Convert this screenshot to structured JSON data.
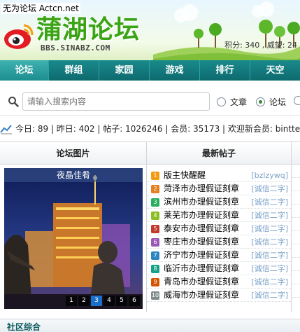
{
  "header": {
    "site_top_text": "无为论坛 Actcn.net",
    "logo_title": "蒲湖论坛",
    "logo_url": "BBS.SINABZ.COM",
    "score_text": "积分: 340 , 威望: 24"
  },
  "nav": {
    "items": [
      "论坛",
      "群组",
      "家园",
      "游戏",
      "排行",
      "天空"
    ]
  },
  "search": {
    "placeholder": "请输入搜索内容",
    "options": [
      "文章",
      "论坛"
    ],
    "selected": "论坛"
  },
  "stats": {
    "text": "今日: 89 | 昨日: 402 | 帖子: 1026246 | 会员: 35173 | 欢迎新会员: bintte"
  },
  "panels": {
    "left_title": "论坛图片",
    "middle_title": "最新帖子",
    "photo_caption": "夜晶佳肴",
    "pager": [
      "1",
      "2",
      "3",
      "4",
      "5",
      "6"
    ],
    "pager_active": "3",
    "posts": [
      {
        "num": "1",
        "title": "版主快醒醒",
        "author": "[bzlzywq]",
        "color": "#f39c12"
      },
      {
        "num": "2",
        "title": "菏泽市办理假证刻章",
        "author": "[诚信二字]",
        "color": "#e67e22"
      },
      {
        "num": "3",
        "title": "滨州市办理假证刻章",
        "author": "[诚信二字]",
        "color": "#27ae60"
      },
      {
        "num": "4",
        "title": "莱芜市办理假证刻章",
        "author": "[诚信二字]",
        "color": "#8cbf26"
      },
      {
        "num": "5",
        "title": "泰安市办理假证刻章",
        "author": "[诚信二字]",
        "color": "#c0392b"
      },
      {
        "num": "6",
        "title": "枣庄市办理假证刻章",
        "author": "[诚信二字]",
        "color": "#9b59b6"
      },
      {
        "num": "7",
        "title": "济宁市办理假证刻章",
        "author": "[诚信二字]",
        "color": "#2e86c1"
      },
      {
        "num": "8",
        "title": "临沂市办理假证刻章",
        "author": "[诚信二字]",
        "color": "#16a085"
      },
      {
        "num": "9",
        "title": "青岛市办理假证刻章",
        "author": "[诚信二字]",
        "color": "#d35400"
      },
      {
        "num": "10",
        "title": "威海市办理假证刻章",
        "author": "[诚信二字]",
        "color": "#7f8c8d"
      }
    ]
  },
  "bottom": {
    "title": "社区综合"
  }
}
